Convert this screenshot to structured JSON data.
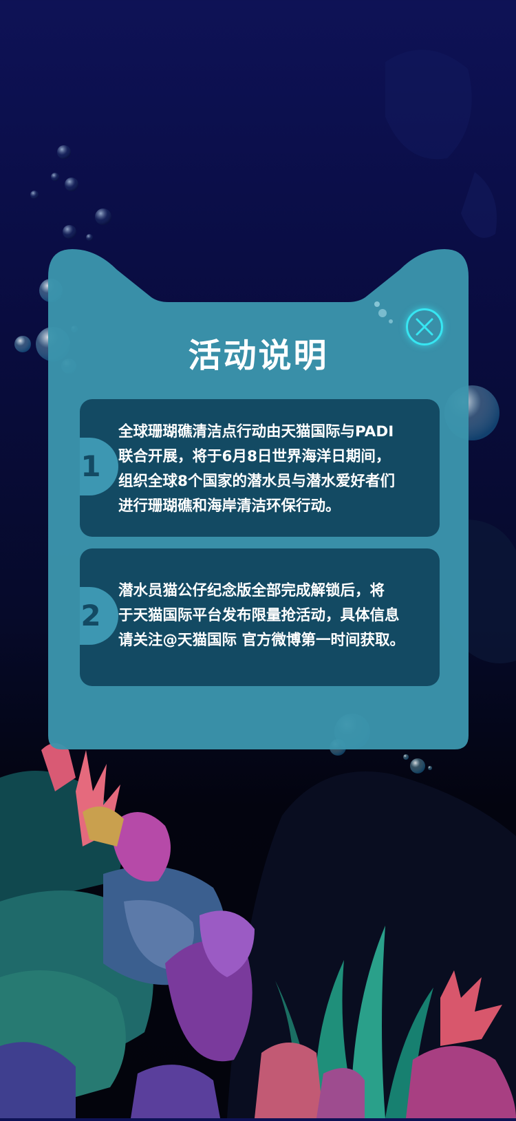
{
  "modal": {
    "title": "活动说明",
    "close_icon": "close-icon",
    "sections": [
      {
        "number": "1",
        "lines": [
          "全球珊瑚礁清洁点行动由天猫国际与PADI",
          "联合开展，将于6月8日世界海洋日期间，",
          "组织全球8个国家的潜水员与潜水爱好者们",
          "进行珊瑚礁和海岸清洁环保行动。"
        ]
      },
      {
        "number": "2",
        "lines": [
          "潜水员猫公仔纪念版全部完成解锁后，将",
          "于天猫国际平台发布限量抢活动，具体信息",
          "请关注@天猫国际 官方微博第一时间获取。"
        ]
      }
    ]
  },
  "colors": {
    "card": "#3b95ad",
    "section_bg": "#134a63",
    "accent": "#37e6f2",
    "ocean_top": "#0e1256",
    "ocean_bottom": "#03040c"
  }
}
